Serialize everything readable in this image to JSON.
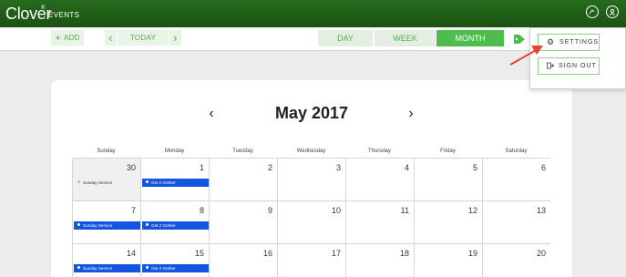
{
  "header": {
    "brand": "Clover",
    "brand_mark": "®",
    "section": "EVENTS",
    "icons": [
      "help-icon",
      "account-icon"
    ]
  },
  "toolbar": {
    "add_label": "ADD",
    "add_prefix": "+",
    "prev": "‹",
    "today_label": "TODAY",
    "next": "›",
    "views": [
      {
        "label": "DAY",
        "active": false
      },
      {
        "label": "WEEK",
        "active": false
      },
      {
        "label": "MONTH",
        "active": true
      }
    ],
    "tag_icon": "tag-icon"
  },
  "menu": {
    "settings_label": "SETTINGS",
    "signout_label": "SIGN OUT"
  },
  "calendar": {
    "title": "May 2017",
    "prev": "‹",
    "next": "›",
    "weekdays": [
      "Sunday",
      "Monday",
      "Tuesday",
      "Wednesday",
      "Thursday",
      "Friday",
      "Saturday"
    ],
    "rows": [
      [
        {
          "day": "30",
          "muted": true,
          "event": "Sunday Service",
          "event_style": "plain"
        },
        {
          "day": "1",
          "event": "Get 2 Gether"
        },
        {
          "day": "2"
        },
        {
          "day": "3"
        },
        {
          "day": "4"
        },
        {
          "day": "5"
        },
        {
          "day": "6"
        }
      ],
      [
        {
          "day": "7",
          "event": "Sunday Service"
        },
        {
          "day": "8",
          "event": "Get 2 Gether"
        },
        {
          "day": "9"
        },
        {
          "day": "10"
        },
        {
          "day": "11"
        },
        {
          "day": "12"
        },
        {
          "day": "13"
        }
      ],
      [
        {
          "day": "14",
          "event": "Sunday Service"
        },
        {
          "day": "15",
          "event": "Get 2 Gether"
        },
        {
          "day": "16"
        },
        {
          "day": "17"
        },
        {
          "day": "18"
        },
        {
          "day": "19"
        },
        {
          "day": "20"
        }
      ]
    ]
  },
  "colors": {
    "header_green": "#1f5e17",
    "active_view": "#4ebd4d",
    "event_blue": "#1354e0",
    "annotation_arrow": "#e8442c"
  }
}
